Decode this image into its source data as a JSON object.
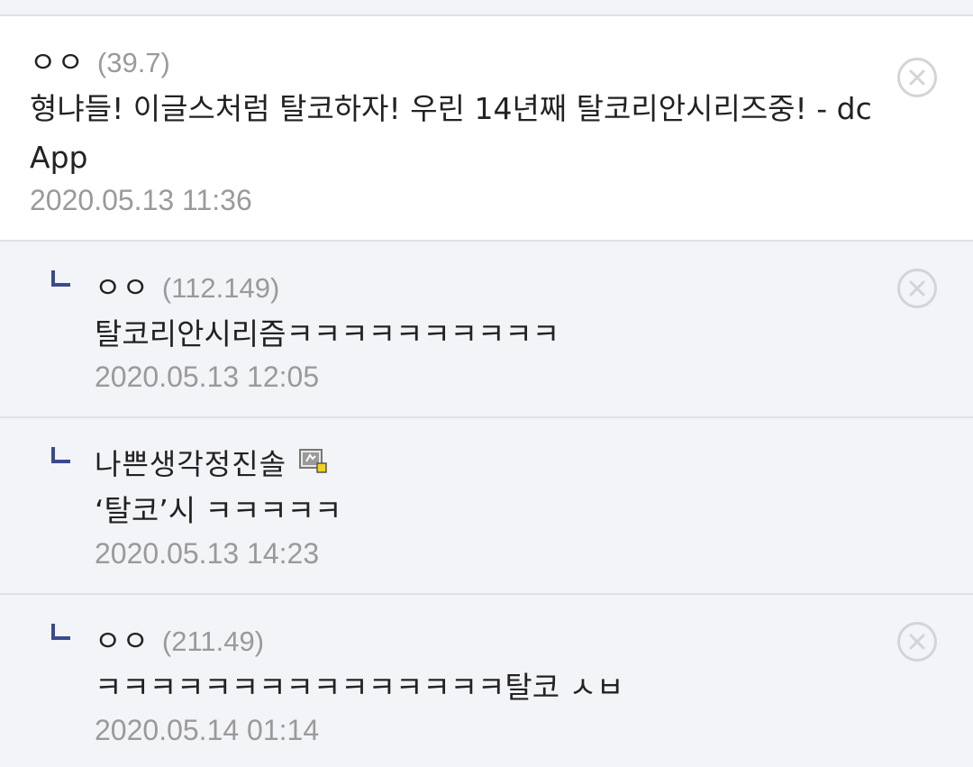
{
  "comments": [
    {
      "type": "main",
      "nickname": "ㅇㅇ",
      "ip": "(39.7)",
      "text": "형냐들! 이글스처럼 탈코하자! 우린 14년째 탈코리안시리즈중! - dc App",
      "date": "2020.05.13 11:36"
    },
    {
      "type": "reply",
      "nickname": "ㅇㅇ",
      "ip": "(112.149)",
      "text": "탈코리안시리즘ㅋㅋㅋㅋㅋㅋㅋㅋㅋㅋ",
      "date": "2020.05.13 12:05"
    },
    {
      "type": "reply",
      "nickname": "나쁜생각정진솔",
      "ip": "",
      "text": "‘탈코’시 ㅋㅋㅋㅋㅋ",
      "date": "2020.05.13 14:23"
    },
    {
      "type": "reply",
      "nickname": "ㅇㅇ",
      "ip": "(211.49)",
      "text": "ㅋㅋㅋㅋㅋㅋㅋㅋㅋㅋㅋㅋㅋㅋㅋ탈코 ㅅㅂ",
      "date": "2020.05.14 01:14"
    }
  ],
  "colors": {
    "reply_bg": "#f3f4f8",
    "divider": "#dfe1e8",
    "muted_text": "#9a9a9a",
    "reply_marker": "#3b4a8c",
    "delete_icon": "#d4d4d8"
  },
  "icons": {
    "delete": "close-circle-icon",
    "reply_marker": "reply-arrow-icon",
    "member_badge": "gallery-member-icon"
  }
}
